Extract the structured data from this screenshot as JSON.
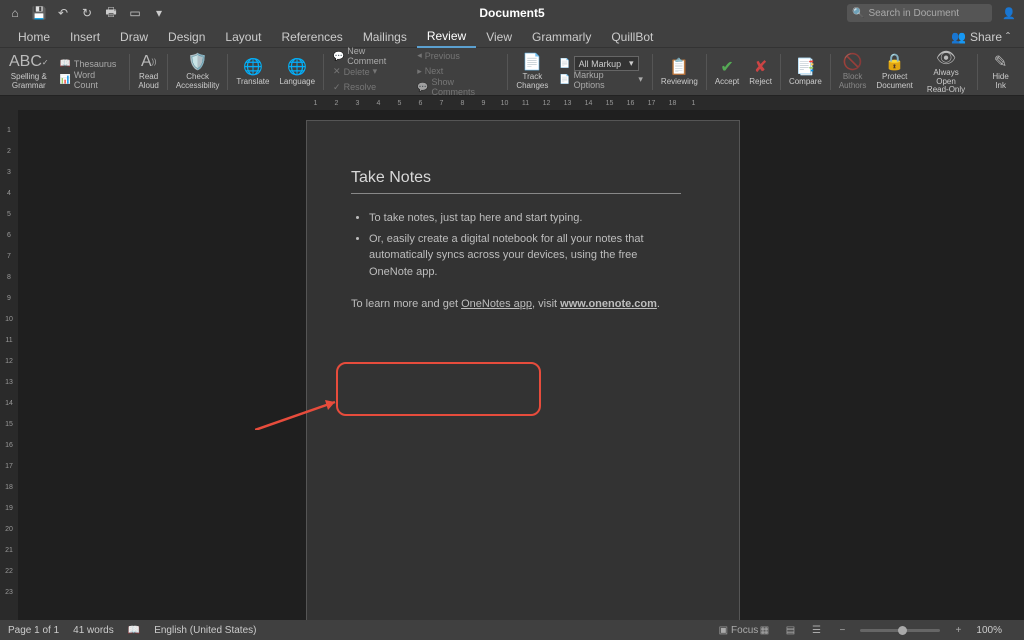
{
  "titlebar": {
    "document_title": "Document5",
    "search_placeholder": "Search in Document"
  },
  "tabs": [
    "Home",
    "Insert",
    "Draw",
    "Design",
    "Layout",
    "References",
    "Mailings",
    "Review",
    "View",
    "Grammarly",
    "QuillBot"
  ],
  "active_tab": "Review",
  "share_label": "Share",
  "ribbon": {
    "spelling": "Spelling &\nGrammar",
    "thesaurus": "Thesaurus",
    "wordcount": "Word Count",
    "read_aloud": "Read\nAloud",
    "check_access": "Check\nAccessibility",
    "translate": "Translate",
    "language": "Language",
    "new_comment": "New Comment",
    "delete": "Delete",
    "resolve": "Resolve",
    "previous": "Previous",
    "next": "Next",
    "show_comments": "Show Comments",
    "track_changes": "Track\nChanges",
    "markup_value": "All Markup",
    "markup_options": "Markup Options",
    "reviewing": "Reviewing",
    "accept": "Accept",
    "reject": "Reject",
    "compare": "Compare",
    "block_authors": "Block\nAuthors",
    "protect_doc": "Protect\nDocument",
    "always_open": "Always Open\nRead-Only",
    "hide_ink": "Hide Ink"
  },
  "document": {
    "heading": "Take Notes",
    "bullet1": "To take notes, just tap here and start typing.",
    "bullet2": "Or, easily create a digital notebook for all your notes that automatically syncs across your devices, using the free OneNote app.",
    "learn_prefix": "To learn more and get ",
    "app_name": "OneNotes app",
    "learn_mid": ", visit ",
    "link": "www.onenote.com",
    "period": "."
  },
  "ruler_marks": [
    "1",
    "2",
    "3",
    "4",
    "5",
    "6",
    "7",
    "8",
    "9",
    "10",
    "11",
    "12",
    "13",
    "14",
    "15",
    "16",
    "17",
    "18",
    "1"
  ],
  "vruler_marks": [
    "1",
    "2",
    "3",
    "4",
    "5",
    "6",
    "7",
    "8",
    "9",
    "10",
    "11",
    "12",
    "13",
    "14",
    "15",
    "16",
    "17",
    "18",
    "19",
    "20",
    "21",
    "22",
    "23"
  ],
  "status": {
    "page": "Page 1 of 1",
    "words": "41 words",
    "lang": "English (United States)",
    "focus": "Focus",
    "zoom": "100%"
  }
}
